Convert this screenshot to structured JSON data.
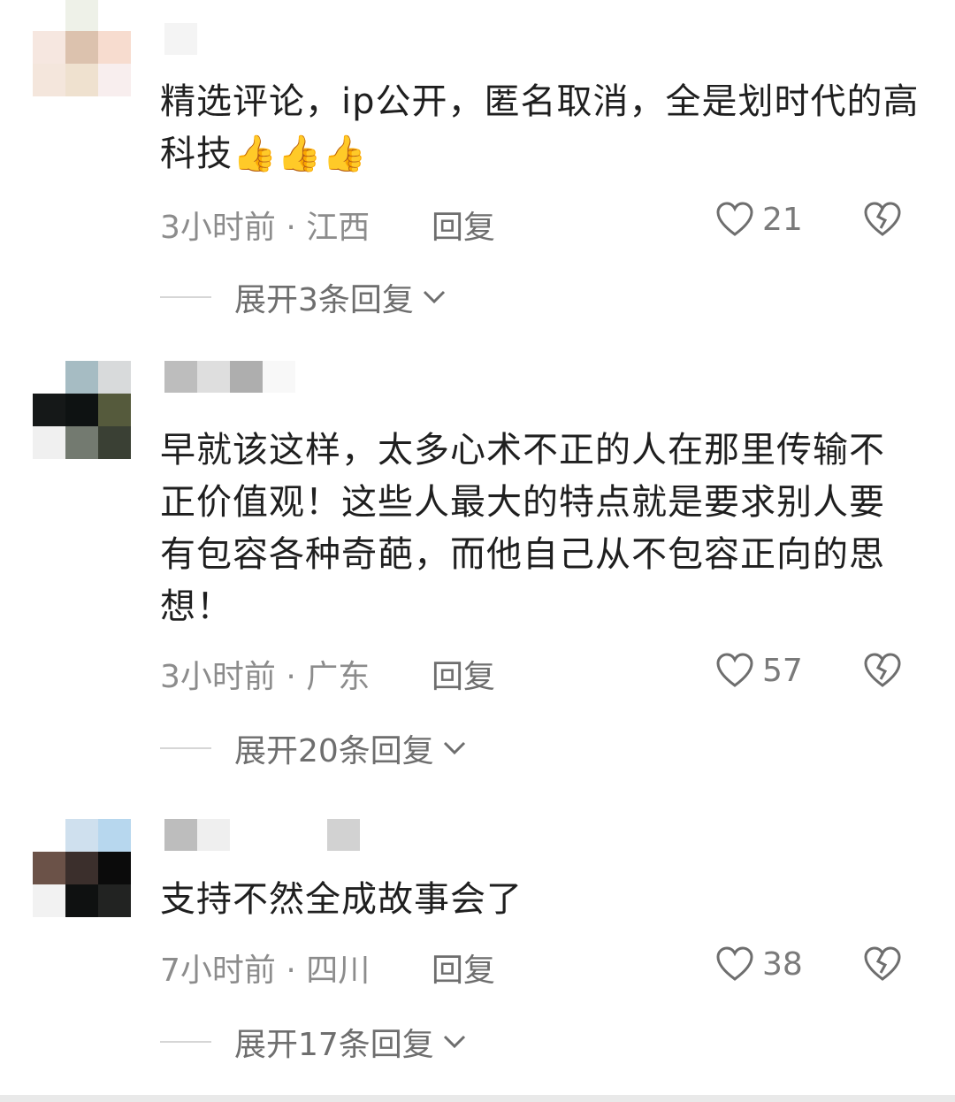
{
  "comments": [
    {
      "text": "精选评论，ip公开，匿名取消，全是划时代的高科技",
      "emoji": "👍👍👍",
      "time_location": "3小时前 · 江西",
      "reply_label": "回复",
      "likes": "21",
      "expand_label": "展开3条回复"
    },
    {
      "text": "早就该这样，太多心术不正的人在那里传输不正价值观！这些人最大的特点就是要求别人要有包容各种奇葩，而他自己从不包容正向的思想！",
      "time_location": "3小时前 · 广东",
      "reply_label": "回复",
      "likes": "57",
      "expand_label": "展开20条回复"
    },
    {
      "text": "支持不然全成故事会了",
      "time_location": "7小时前 · 四川",
      "reply_label": "回复",
      "likes": "38",
      "expand_label": "展开17条回复"
    }
  ],
  "icons": {
    "like": "heart-outline-icon",
    "dislike": "broken-heart-icon",
    "expand": "chevron-down-icon"
  },
  "colors": {
    "text": "#1f1f1f",
    "meta": "#8c8c8c",
    "icon": "#6e6e6e"
  }
}
